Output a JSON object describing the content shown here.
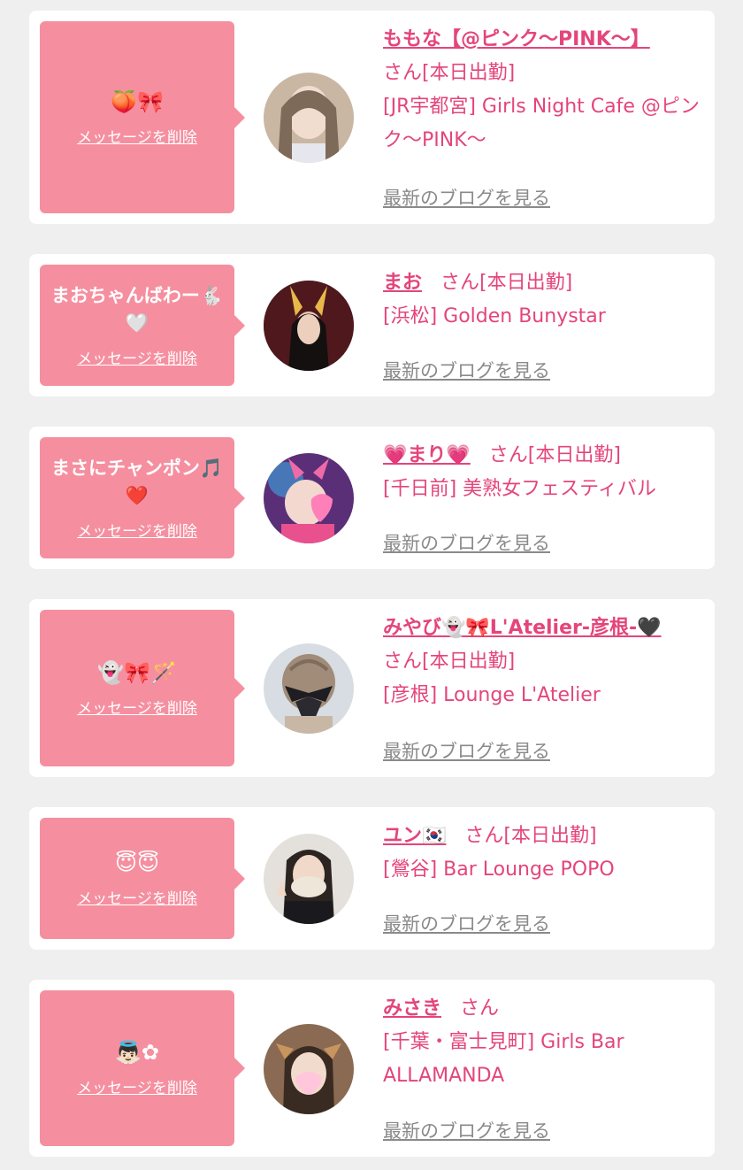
{
  "common": {
    "delete_label": "メッセージを削除",
    "blog_label": "最新のブログを見る"
  },
  "cards": [
    {
      "message": "🍑🎀",
      "name": "ももな【@ピンク〜PINK〜】",
      "honorific": "さん[本日出勤]",
      "shop": "[JR宇都宮] Girls Night Cafe @ピンク〜PINK〜"
    },
    {
      "message": "まおちゃんばわー🐇🤍",
      "name": "まお",
      "honorific": "さん[本日出勤]",
      "shop": "[浜松] Golden Bunystar"
    },
    {
      "message": "まさにチャンポン🎵❤️",
      "name": "💗まり💗",
      "honorific": "さん[本日出勤]",
      "shop": "[千日前] 美熟女フェスティバル"
    },
    {
      "message": "👻🎀🪄",
      "name": "みやび👻🎀L'Atelier-彦根-🖤",
      "honorific": "さん[本日出勤]",
      "shop": "[彦根] Lounge L'Atelier"
    },
    {
      "message": "😇😇",
      "name": "ユン🇰🇷",
      "honorific": "さん[本日出勤]",
      "shop": "[鶯谷] Bar Lounge POPO"
    },
    {
      "message": "👼🏻✿",
      "name": "みさき",
      "honorific": "さん",
      "shop": "[千葉・富士見町] Girls Bar ALLAMANDA"
    }
  ]
}
